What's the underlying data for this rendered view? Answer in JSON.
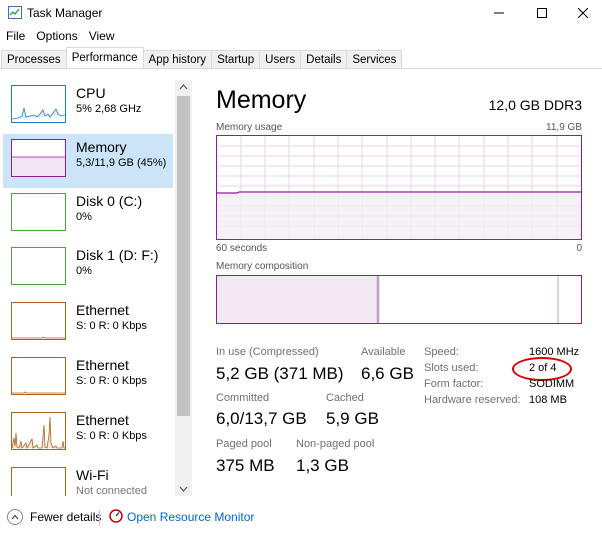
{
  "window": {
    "title": "Task Manager",
    "minimize_icon": "minimize-icon",
    "maximize_icon": "maximize-icon",
    "close_icon": "close-icon"
  },
  "menu": [
    "File",
    "Options",
    "View"
  ],
  "tabs": [
    "Processes",
    "Performance",
    "App history",
    "Startup",
    "Users",
    "Details",
    "Services"
  ],
  "active_tab": "Performance",
  "sidebar": [
    {
      "title": "CPU",
      "subtitle": "5% 2,68 GHz",
      "color": "#1f7fc9"
    },
    {
      "title": "Memory",
      "subtitle": "5,3/11,9 GB (45%)",
      "color": "#8b1e94"
    },
    {
      "title": "Disk 0 (C:)",
      "subtitle": "0%",
      "color": "#4da538"
    },
    {
      "title": "Disk 1 (D: F:)",
      "subtitle": "0%",
      "color": "#4da538"
    },
    {
      "title": "Ethernet",
      "subtitle": "S: 0 R: 0 Kbps",
      "color": "#b0621a"
    },
    {
      "title": "Ethernet",
      "subtitle": "S: 0 R: 0 Kbps",
      "color": "#b0621a"
    },
    {
      "title": "Ethernet",
      "subtitle": "S: 0 R: 0 Kbps",
      "color": "#b0621a"
    },
    {
      "title": "Wi-Fi",
      "subtitle": "Not connected",
      "color": "#b0621a"
    }
  ],
  "main": {
    "title": "Memory",
    "spec": "12,0 GB DDR3",
    "usage_label": "Memory usage",
    "usage_max": "11,9 GB",
    "time_left": "60 seconds",
    "time_right": "0",
    "composition_label": "Memory composition",
    "usage_percent": 45,
    "accent": "#8b1e94"
  },
  "stats": {
    "in_use_label": "In use (Compressed)",
    "in_use_value": "5,2 GB (371 MB)",
    "available_label": "Available",
    "available_value": "6,6 GB",
    "committed_label": "Committed",
    "committed_value": "6,0/13,7 GB",
    "cached_label": "Cached",
    "cached_value": "5,9 GB",
    "paged_label": "Paged pool",
    "paged_value": "375 MB",
    "nonpaged_label": "Non-paged pool",
    "nonpaged_value": "1,3 GB"
  },
  "details": [
    {
      "label": "Speed:",
      "value": "1600 MHz"
    },
    {
      "label": "Slots used:",
      "value": "2 of 4"
    },
    {
      "label": "Form factor:",
      "value": "SODIMM"
    },
    {
      "label": "Hardware reserved:",
      "value": "108 MB"
    }
  ],
  "footer": {
    "fewer": "Fewer details",
    "monitor": "Open Resource Monitor"
  }
}
